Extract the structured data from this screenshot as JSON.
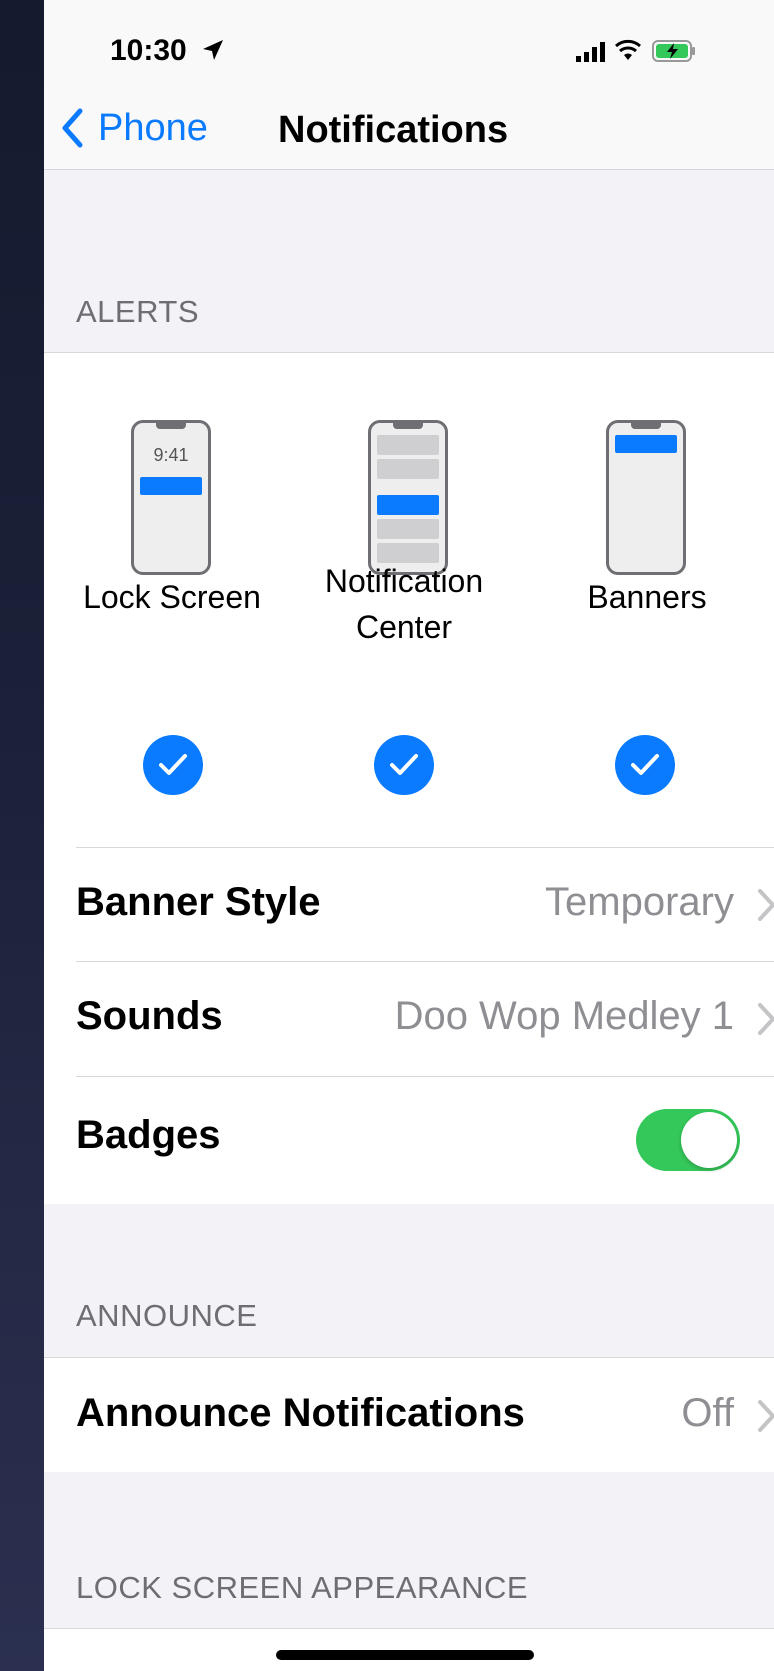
{
  "status_bar": {
    "time": "10:30"
  },
  "nav": {
    "back_label": "Phone",
    "title": "Notifications"
  },
  "alerts": {
    "header": "ALERTS",
    "lock_screen": {
      "label": "Lock Screen",
      "preview_time": "9:41",
      "checked": true
    },
    "notification_center": {
      "label_line1": "Notification",
      "label_line2": "Center",
      "checked": true
    },
    "banners": {
      "label": "Banners",
      "checked": true
    }
  },
  "rows": {
    "banner_style": {
      "label": "Banner Style",
      "value": "Temporary"
    },
    "sounds": {
      "label": "Sounds",
      "value": "Doo Wop Medley 1"
    },
    "badges": {
      "label": "Badges",
      "enabled": true
    }
  },
  "announce": {
    "header": "ANNOUNCE",
    "row": {
      "label": "Announce Notifications",
      "value": "Off"
    }
  },
  "lock_screen_appearance": {
    "header": "LOCK SCREEN APPEARANCE"
  },
  "colors": {
    "accent": "#0a7aff",
    "toggle_on": "#34c759",
    "secondary_text": "#8e8e93"
  }
}
